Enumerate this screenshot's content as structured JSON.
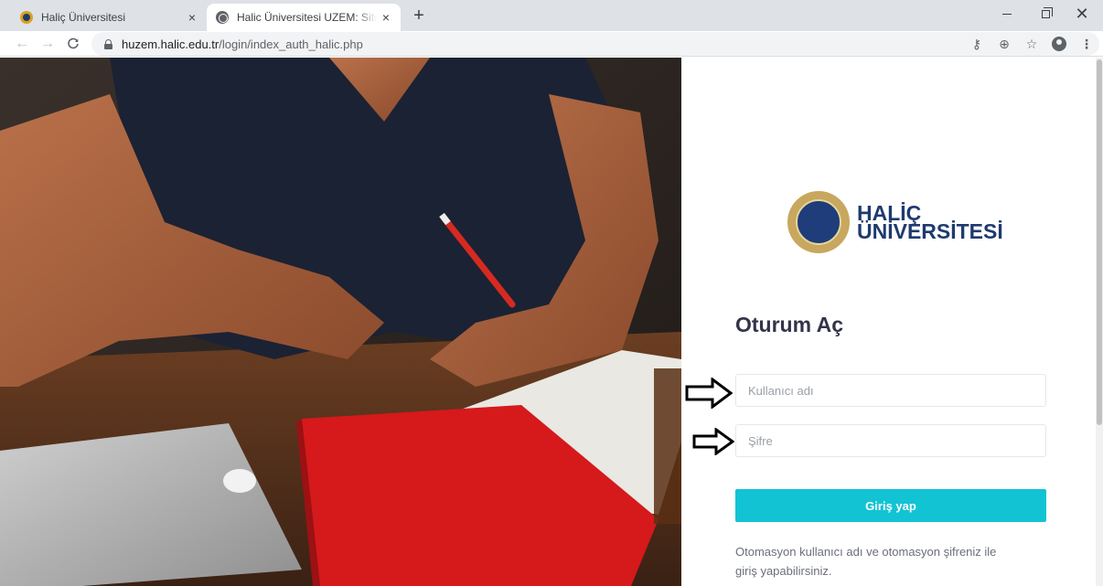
{
  "browser": {
    "tabs": [
      {
        "title": "Haliç Üniversitesi",
        "close": "×"
      },
      {
        "title": "Halic Üniversitesi UZEM: Siteye g",
        "close": "×"
      }
    ],
    "new_tab": "+",
    "window": {
      "minimize": "",
      "restore": "",
      "close": "✕"
    },
    "nav": {
      "back": "←",
      "forward": "→",
      "reload": "C"
    },
    "address": {
      "host": "huzem.halic.edu.tr",
      "path": "/login/index_auth_halic.php"
    },
    "omnibox_icons": {
      "key": "⚷",
      "zoom": "⊕",
      "bookmark": "☆",
      "menu": "⋮"
    }
  },
  "page": {
    "logo": {
      "line1": "HALİÇ",
      "line2": "ÜNİVERSİTESİ"
    },
    "heading": "Oturum Aç",
    "username": {
      "placeholder": "Kullanıcı adı",
      "value": ""
    },
    "password": {
      "placeholder": "Şifre",
      "value": ""
    },
    "submit_label": "Giriş yap",
    "help_text": "Otomasyon kullanıcı adı ve otomasyon şifreniz ile giriş yapabilirsiniz."
  },
  "colors": {
    "accent": "#12c3d4",
    "logo_navy": "#1f3a6e",
    "tabstrip": "#dee1e6"
  }
}
